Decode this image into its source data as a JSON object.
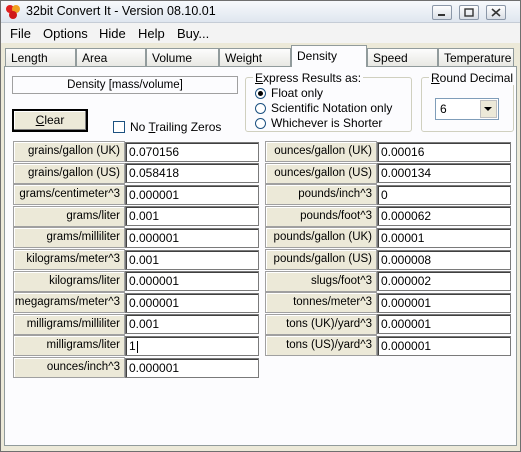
{
  "window": {
    "title": "32bit Convert It - Version 08.10.01",
    "controls": {
      "minimize": "minimize-icon",
      "maximize": "maximize-icon",
      "close": "close-icon"
    }
  },
  "menu": [
    "File",
    "Options",
    "Hide",
    "Help",
    "Buy..."
  ],
  "tabs": [
    "Length",
    "Area",
    "Volume",
    "Weight",
    "Density",
    "Speed",
    "Temperature"
  ],
  "active_tab": "Density",
  "heading": "Density [mass/volume]",
  "express": {
    "legend": "Express Results as:",
    "options": [
      "Float only",
      "Scientific Notation only",
      "Whichever is Shorter"
    ],
    "selected": "Float only"
  },
  "round": {
    "legend": "Round Decimal",
    "value": "6"
  },
  "clear_label": "Clear",
  "no_trailing_label": "No Trailing Zeros",
  "no_trailing_checked": false,
  "left_rows": [
    {
      "label": "grains/gallon (UK)",
      "value": "0.070156"
    },
    {
      "label": "grains/gallon (US)",
      "value": "0.058418"
    },
    {
      "label": "grams/centimeter^3",
      "value": "0.000001"
    },
    {
      "label": "grams/liter",
      "value": "0.001"
    },
    {
      "label": "grams/milliliter",
      "value": "0.000001"
    },
    {
      "label": "kilograms/meter^3",
      "value": "0.001"
    },
    {
      "label": "kilograms/liter",
      "value": "0.000001"
    },
    {
      "label": "megagrams/meter^3",
      "value": "0.000001"
    },
    {
      "label": "milligrams/milliliter",
      "value": "0.001"
    },
    {
      "label": "milligrams/liter",
      "value": "1"
    },
    {
      "label": "ounces/inch^3",
      "value": "0.000001"
    }
  ],
  "right_rows": [
    {
      "label": "ounces/gallon (UK)",
      "value": "0.00016"
    },
    {
      "label": "ounces/gallon (US)",
      "value": "0.000134"
    },
    {
      "label": "pounds/inch^3",
      "value": "0"
    },
    {
      "label": "pounds/foot^3",
      "value": "0.000062"
    },
    {
      "label": "pounds/gallon (UK)",
      "value": "0.00001"
    },
    {
      "label": "pounds/gallon (US)",
      "value": "0.000008"
    },
    {
      "label": "slugs/foot^3",
      "value": "0.000002"
    },
    {
      "label": "tonnes/meter^3",
      "value": "0.000001"
    },
    {
      "label": "tons (UK)/yard^3",
      "value": "0.000001"
    },
    {
      "label": "tons (US)/yard^3",
      "value": "0.000001"
    }
  ]
}
